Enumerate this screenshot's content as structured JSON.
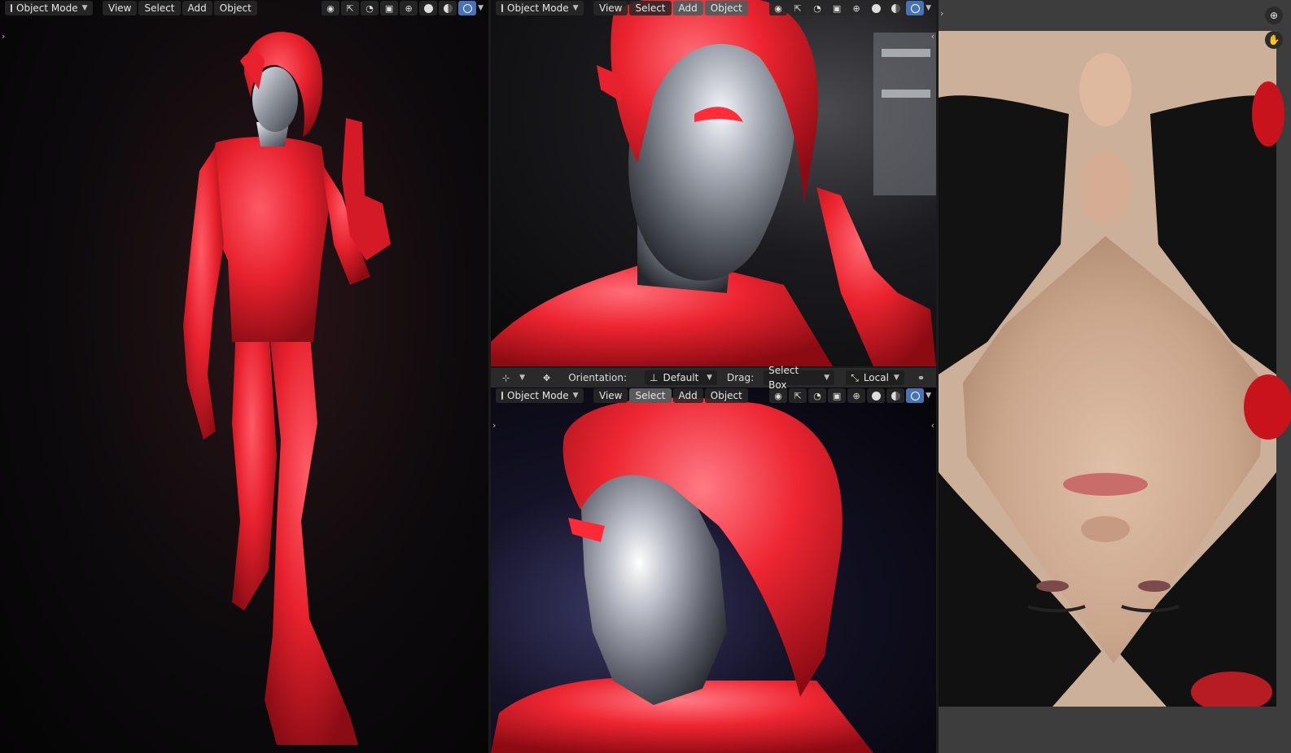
{
  "viewport_header": {
    "mode_label": "Object Mode",
    "menu": [
      "View",
      "Select",
      "Add",
      "Object"
    ]
  },
  "tool_header": {
    "orientation_label": "Orientation:",
    "orientation_value": "Default",
    "drag_label": "Drag:",
    "drag_value": "Select Box",
    "pivot_value": "Local"
  },
  "icons": [
    "object-mode-icon",
    "eye-icon",
    "gizmo-icon",
    "overlay-icon",
    "xray-icon",
    "wireframe-shading-icon",
    "solid-shading-icon",
    "material-shading-icon",
    "rendered-shading-icon",
    "zoom-icon",
    "hand-icon",
    "transform-icon",
    "move-icon",
    "link-icon"
  ],
  "colors": {
    "accent": "#4772b3",
    "model_red": "#e8212e",
    "chrome": "#b9bcc4",
    "skin": "#d7b79f",
    "hair": "#111111"
  }
}
